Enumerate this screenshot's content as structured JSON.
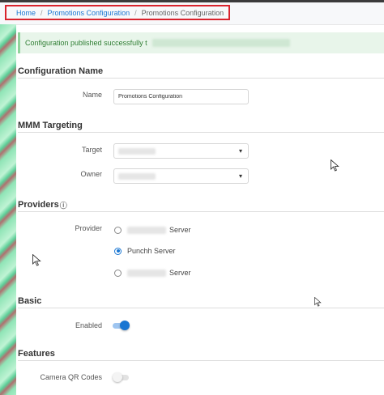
{
  "breadcrumb": {
    "home": "Home",
    "sep1": "/",
    "promotions": "Promotions Configuration",
    "sep2": "/",
    "current": "Promotions Configuration"
  },
  "alert": {
    "message": "Configuration published successfully t"
  },
  "sections": {
    "configuration_name": "Configuration Name",
    "mmm_targeting": "MMM Targeting",
    "providers": "Providers",
    "providers_info_icon": "ⓘ",
    "basic": "Basic",
    "features": "Features"
  },
  "fields": {
    "name_label": "Name",
    "name_value": "Promotions Configuration",
    "target_label": "Target",
    "owner_label": "Owner",
    "caret": "▾",
    "provider_label": "Provider",
    "enabled_label": "Enabled",
    "camera_qr_label": "Camera QR Codes"
  },
  "providers": {
    "option1_suffix": "Server",
    "option2": "Punchh Server",
    "option3_suffix": "Server",
    "selected": "Punchh Server"
  },
  "toggles": {
    "enabled": true,
    "camera_qr_codes": false
  },
  "colors": {
    "accent": "#1976d2",
    "alert_text": "#2e7d32",
    "alert_bg": "#e8f5ea",
    "breadcrumb_highlight": "#d9232d"
  }
}
